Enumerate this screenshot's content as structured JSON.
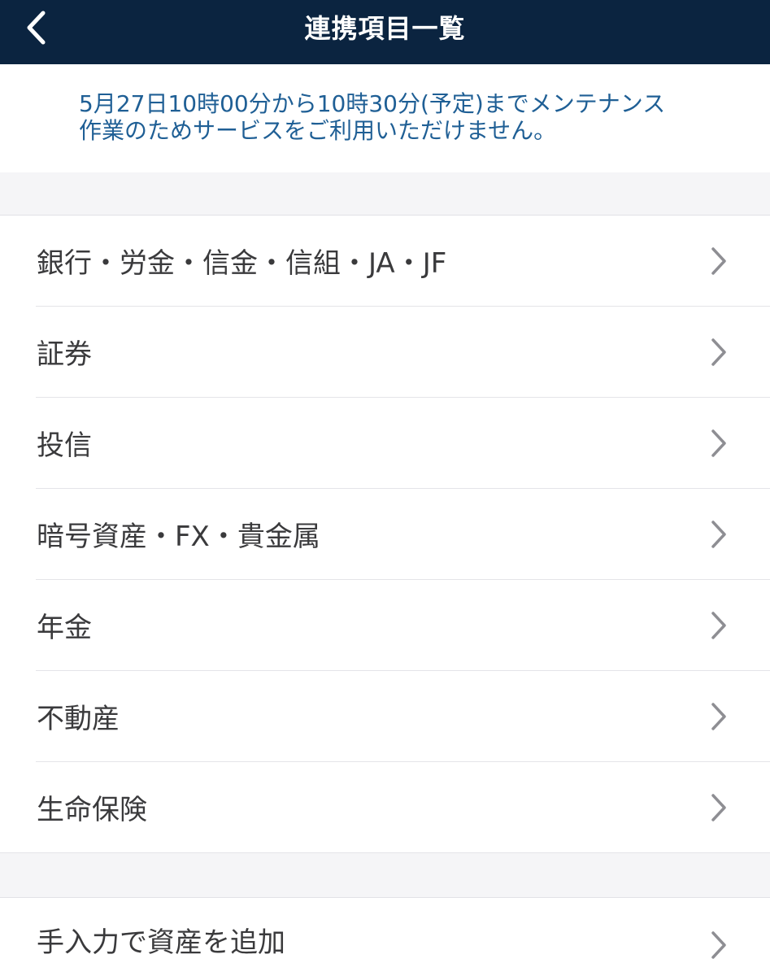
{
  "nav": {
    "title": "連携項目一覧",
    "back_icon": "chevron-left-icon",
    "background": "#0b2440"
  },
  "notice": {
    "text": "5月27日10時00分から10時30分(予定)までメンテナンス\n作業のためサービスをご利用いただけません。",
    "color": "#1f5f95"
  },
  "categories": [
    {
      "label": "銀行・労金・信金・信組・JA・JF"
    },
    {
      "label": "証券"
    },
    {
      "label": "投信"
    },
    {
      "label": "暗号資産・FX・貴金属"
    },
    {
      "label": "年金"
    },
    {
      "label": "不動産"
    },
    {
      "label": "生命保険"
    }
  ],
  "manual": {
    "label": "手入力で資産を追加"
  },
  "icons": {
    "row_chevron": "chevron-right-icon"
  }
}
